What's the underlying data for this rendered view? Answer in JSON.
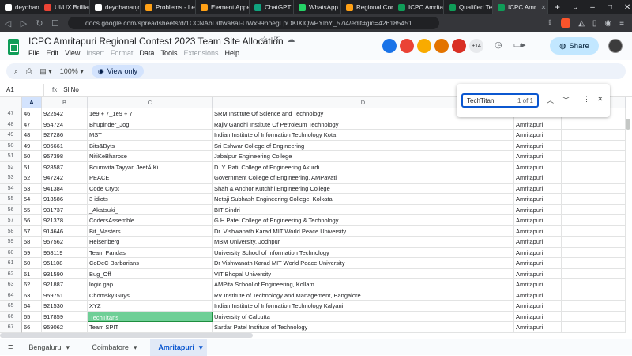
{
  "browser": {
    "tabs": [
      {
        "label": "deydhananjoy",
        "color": "#ffffff"
      },
      {
        "label": "UI/UX Brillian",
        "color": "#ea4335"
      },
      {
        "label": "deydhananjoy",
        "color": "#ffffff"
      },
      {
        "label": "Problems - Le",
        "color": "#ffa116"
      },
      {
        "label": "Element Appe",
        "color": "#ffa116"
      },
      {
        "label": "ChatGPT",
        "color": "#10a37f"
      },
      {
        "label": "WhatsApp",
        "color": "#25d366"
      },
      {
        "label": "Regional Con",
        "color": "#ffa116"
      },
      {
        "label": "ICPC Amritap",
        "color": "#0f9d58"
      },
      {
        "label": "Qualified Tea",
        "color": "#0f9d58"
      },
      {
        "label": "ICPC Amr",
        "color": "#0f9d58"
      }
    ],
    "url": "docs.google.com/spreadsheets/d/1CCNAbDittwa8aI-UWx99hoegLpOKlXlQwPYlbY_57i4/edit#gid=426185451"
  },
  "doc": {
    "title": "ICPC Amritapuri Regional Contest 2023 Team Site Allocation",
    "menu": [
      "File",
      "Edit",
      "View",
      "Insert",
      "Format",
      "Data",
      "Tools",
      "Extensions",
      "Help"
    ],
    "collaborator_count": "+14",
    "share_label": "Share"
  },
  "toolbar": {
    "zoom": "100%",
    "view_only": "View only"
  },
  "formula": {
    "cell_ref": "A1",
    "fx": "fx",
    "value": "Sl No"
  },
  "find": {
    "query": "TechTitan",
    "count": "1 of 1"
  },
  "columns": [
    "A",
    "B",
    "C",
    "D",
    "E"
  ],
  "rows": [
    {
      "r": "47",
      "a": "46",
      "b": "922542",
      "c": "1e9 + 7_1e9 + 7",
      "d": "SRM Institute Of Science and Technology",
      "e": "Amritapuri"
    },
    {
      "r": "48",
      "a": "47",
      "b": "954724",
      "c": "Bhupinder_Jogi",
      "d": "Rajiv Gandhi Institute Of Petroleum Technology",
      "e": "Amritapuri"
    },
    {
      "r": "49",
      "a": "48",
      "b": "927286",
      "c": "MST",
      "d": "Indian Institute of Information Technology Kota",
      "e": "Amritapuri"
    },
    {
      "r": "50",
      "a": "49",
      "b": "906661",
      "c": "Bits&Byts",
      "d": "Sri Eshwar College of Engineering",
      "e": "Amritapuri"
    },
    {
      "r": "51",
      "a": "50",
      "b": "957398",
      "c": "NitiKeBharose",
      "d": "Jabalpur Engineering College",
      "e": "Amritapuri"
    },
    {
      "r": "52",
      "a": "51",
      "b": "928587",
      "c": "Bournvita Tayyari JeetÃ Ki",
      "d": "D. Y. Patil College of Engineering Akurdi",
      "e": "Amritapuri"
    },
    {
      "r": "53",
      "a": "52",
      "b": "947242",
      "c": "PEACE",
      "d": "Government College of Engineering, AMPavati",
      "e": "Amritapuri"
    },
    {
      "r": "54",
      "a": "53",
      "b": "941384",
      "c": "Code Crypt",
      "d": "Shah & Anchor Kutchhi Engineering College",
      "e": "Amritapuri"
    },
    {
      "r": "55",
      "a": "54",
      "b": "913586",
      "c": "3 idiots",
      "d": "Netaji Subhash Engineering College, Kolkata",
      "e": "Amritapuri"
    },
    {
      "r": "56",
      "a": "55",
      "b": "931737",
      "c": "_Akatsuki_",
      "d": "BIT Sindri",
      "e": "Amritapuri"
    },
    {
      "r": "57",
      "a": "56",
      "b": "921378",
      "c": "CodersAssemble",
      "d": "G H Patel College of Engineering & Technology",
      "e": "Amritapuri"
    },
    {
      "r": "58",
      "a": "57",
      "b": "914646",
      "c": "Bit_Masters",
      "d": "Dr. Vishwanath Karad MIT World Peace University",
      "e": "Amritapuri"
    },
    {
      "r": "59",
      "a": "58",
      "b": "957562",
      "c": "Heisenberg",
      "d": "MBM University, Jodhpur",
      "e": "Amritapuri"
    },
    {
      "r": "60",
      "a": "59",
      "b": "958119",
      "c": "Team Pandas",
      "d": "University School of Information Technology",
      "e": "Amritapuri"
    },
    {
      "r": "61",
      "a": "60",
      "b": "951108",
      "c": "CoDeC Barbarians",
      "d": "Dr Vishwanath Karad MIT World Peace University",
      "e": "Amritapuri"
    },
    {
      "r": "62",
      "a": "61",
      "b": "931590",
      "c": "Bug_Off",
      "d": "VIT Bhopal University",
      "e": "Amritapuri"
    },
    {
      "r": "63",
      "a": "62",
      "b": "921887",
      "c": "logic.gap",
      "d": "AMPita School of Engineering, Kollam",
      "e": "Amritapuri"
    },
    {
      "r": "64",
      "a": "63",
      "b": "959751",
      "c": "Chomsky Guys",
      "d": "RV Institute of Technology and Management, Bangalore",
      "e": "Amritapuri"
    },
    {
      "r": "65",
      "a": "64",
      "b": "921530",
      "c": "XYZ",
      "d": "Indian Institute of Information Technology Kalyani",
      "e": "Amritapuri"
    },
    {
      "r": "66",
      "a": "65",
      "b": "917859",
      "c": "TechTitans",
      "d": "University of Calcutta",
      "e": "Amritapuri"
    },
    {
      "r": "67",
      "a": "66",
      "b": "959062",
      "c": "Team SPIT",
      "d": "Sardar Patel Institute of Technology",
      "e": "Amritapuri"
    }
  ],
  "sheets": [
    {
      "label": "Bengaluru"
    },
    {
      "label": "Coimbatore"
    },
    {
      "label": "Amritapuri"
    }
  ]
}
